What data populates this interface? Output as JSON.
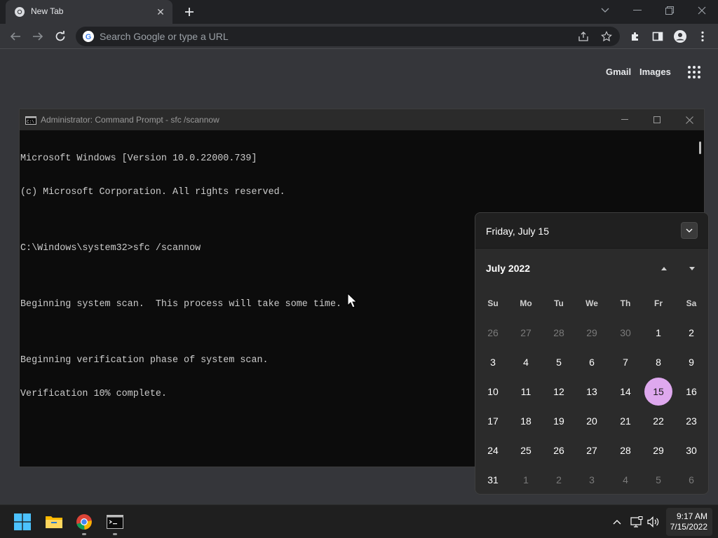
{
  "browser": {
    "tab": {
      "title": "New Tab",
      "favicon": "chrome-icon"
    },
    "omnibox": {
      "placeholder": "Search Google or type a URL"
    },
    "new_tab_page": {
      "links": [
        "Gmail",
        "Images"
      ]
    }
  },
  "cmd": {
    "title": "Administrator: Command Prompt - sfc  /scannow",
    "lines": [
      "Microsoft Windows [Version 10.0.22000.739]",
      "(c) Microsoft Corporation. All rights reserved.",
      "",
      "C:\\Windows\\system32>sfc /scannow",
      "",
      "Beginning system scan.  This process will take some time.",
      "",
      "Beginning verification phase of system scan.",
      "Verification 10% complete."
    ]
  },
  "calendar": {
    "header_date": "Friday, July 15",
    "month_label": "July 2022",
    "weekdays": [
      "Su",
      "Mo",
      "Tu",
      "We",
      "Th",
      "Fr",
      "Sa"
    ],
    "weeks": [
      [
        "26",
        "27",
        "28",
        "29",
        "30",
        "1",
        "2"
      ],
      [
        "3",
        "4",
        "5",
        "6",
        "7",
        "8",
        "9"
      ],
      [
        "10",
        "11",
        "12",
        "13",
        "14",
        "15",
        "16"
      ],
      [
        "17",
        "18",
        "19",
        "20",
        "21",
        "22",
        "23"
      ],
      [
        "24",
        "25",
        "26",
        "27",
        "28",
        "29",
        "30"
      ],
      [
        "31",
        "1",
        "2",
        "3",
        "4",
        "5",
        "6"
      ]
    ],
    "selected": "15",
    "selected_color": "#dea8ee"
  },
  "taskbar": {
    "apps": [
      "windows-start-icon",
      "file-explorer-icon",
      "chrome-icon",
      "command-prompt-icon"
    ],
    "clock": {
      "time": "9:17 AM",
      "date": "7/15/2022"
    }
  }
}
